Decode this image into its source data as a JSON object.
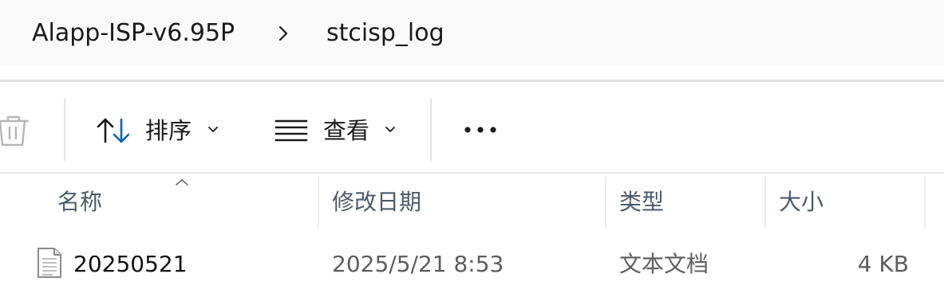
{
  "breadcrumb": {
    "items": [
      "Alapp-ISP-v6.95P",
      "stcisp_log"
    ],
    "separator_icon": "chevron-right-icon"
  },
  "toolbar": {
    "delete_icon": "trash-icon",
    "sort": {
      "label": "排序",
      "icon": "sort-arrows-icon"
    },
    "view": {
      "label": "查看",
      "icon": "view-lines-icon"
    },
    "more_icon": "more-ellipsis-icon"
  },
  "columns": {
    "name": "名称",
    "modified": "修改日期",
    "type": "类型",
    "size": "大小",
    "sorted_by": "name",
    "sort_indicator_icon": "chevron-up-icon"
  },
  "files": [
    {
      "name": "20250521",
      "modified": "2025/5/21 8:53",
      "type": "文本文档",
      "size": "4 KB",
      "icon": "text-file-icon"
    }
  ],
  "colors": {
    "accent": "#0067c0",
    "header_text": "#4c5a6a",
    "secondary_text": "#5d5d5d"
  }
}
